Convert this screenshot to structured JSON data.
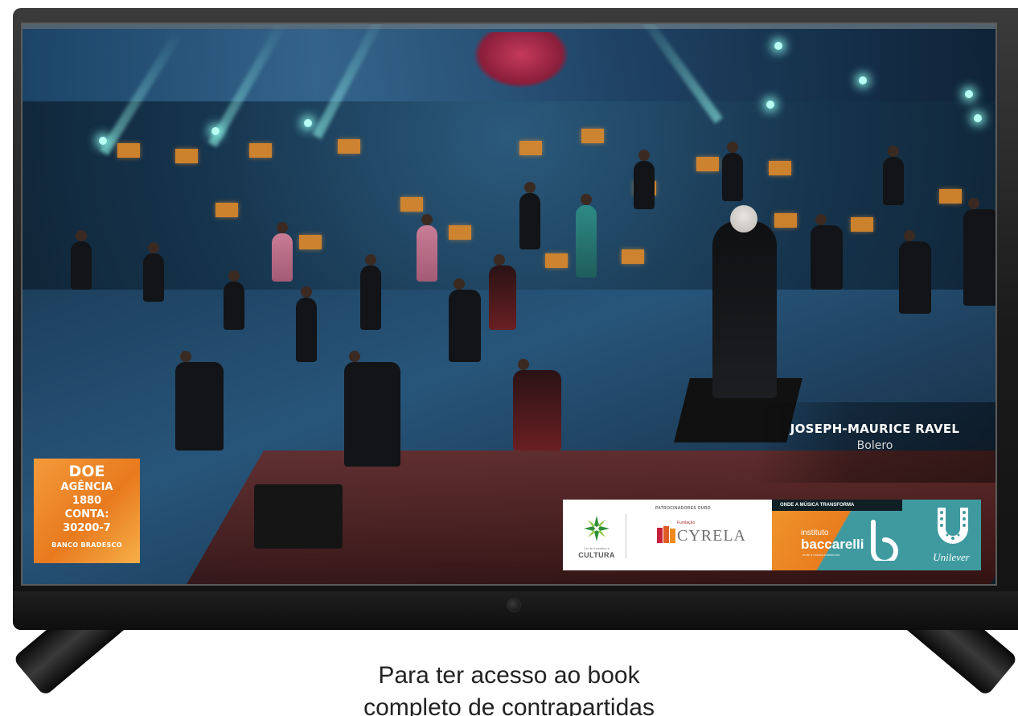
{
  "overlay": {
    "composer_name": "JOSEPH-MAURICE RAVEL",
    "piece_title": "Bolero"
  },
  "donation": {
    "title": "DOE",
    "agency_label": "AGÊNCIA",
    "agency_number": "1880",
    "account_label": "CONTA:",
    "account_number": "30200-7",
    "bank": "BANCO BRADESCO",
    "color": "#ee8a27"
  },
  "sponsors": {
    "patrocinadores_label": "PATROCINADORES OURO",
    "cultura_small": "Lei de Incentivo à",
    "cultura": "CULTURA",
    "cyrela_small": "Fundação",
    "cyrela": "CYRELA",
    "onde_label": "ONDE A MÚSICA TRANSFORMA",
    "baccarelli_small": "instituto",
    "baccarelli": "baccarelli",
    "baccarelli_sub": "onde a música transforma",
    "unilever": "Unilever",
    "teal_color": "#3f9aa0"
  },
  "caption": {
    "line1": "Para ter acesso ao book",
    "line2": "completo de contrapartidas"
  }
}
